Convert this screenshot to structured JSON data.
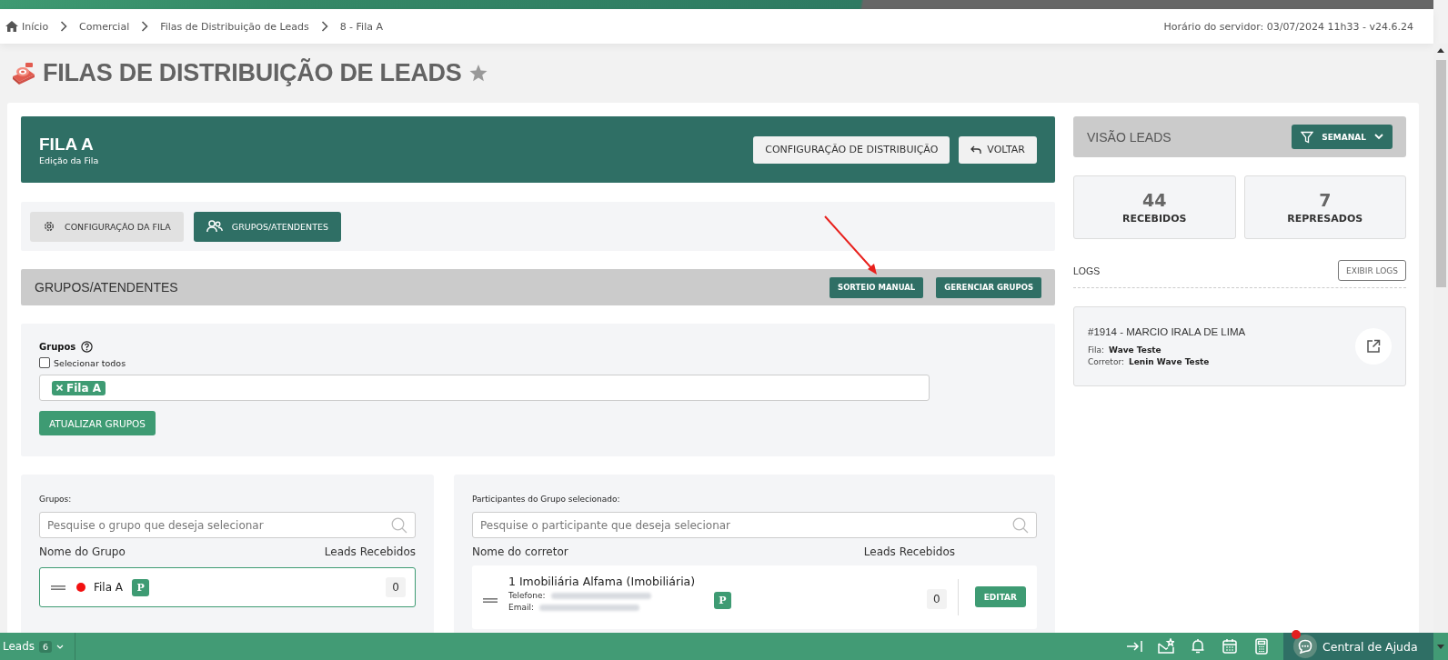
{
  "breadcrumb": [
    {
      "label": "Início",
      "kind": "home"
    },
    {
      "label": "Comercial",
      "kind": "link"
    },
    {
      "label": "Filas de Distribuição de Leads",
      "kind": "link"
    },
    {
      "label": "8 - Fila A",
      "kind": "current"
    }
  ],
  "server_time": "Horário do servidor: 03/07/2024 11h33 - v24.6.24",
  "page_title": "FILAS DE DISTRIBUIÇÃO DE LEADS",
  "favorite": false,
  "queue_header": {
    "title": "FILA A",
    "subtitle": "Edição da Fila",
    "buttons": [
      {
        "label": "CONFIGURAÇÃO DE DISTRIBUIÇÃO",
        "kind": "plain"
      },
      {
        "label": "VOLTAR",
        "kind": "back"
      }
    ]
  },
  "tabs": [
    {
      "label": "CONFIGURAÇÃO DA FILA",
      "kind": "gear",
      "selected": false
    },
    {
      "label": "GRUPOS/ATENDENTES",
      "kind": "users",
      "selected": true
    }
  ],
  "section": {
    "title": "GRUPOS/ATENDENTES",
    "buttons": [
      "SORTEIO MANUAL",
      "GERENCIAR GRUPOS"
    ]
  },
  "groups_form": {
    "label": "Grupos",
    "select_all": {
      "label": "Selecionar todos",
      "checked": false
    },
    "tags": [
      "Fila A"
    ],
    "submit": "ATUALIZAR GRUPOS"
  },
  "groups_list": {
    "label": "Grupos:",
    "search_placeholder": "Pesquise o grupo que deseja selecionar",
    "columns": [
      "Nome do Grupo",
      "Leads Recebidos"
    ],
    "rows": [
      {
        "name": "Fila A",
        "color": "#f21010",
        "badge": "P",
        "count": "0",
        "selected": true
      }
    ]
  },
  "participants": {
    "label": "Participantes do Grupo selecionado:",
    "search_placeholder": "Pesquise o participante que deseja selecionar",
    "columns": [
      "Nome do corretor",
      "Leads Recebidos"
    ],
    "rows": [
      {
        "name": "1 Imobiliária Alfama (Imobiliária)",
        "phone_label": "Telefone:",
        "email_label": "Email:",
        "badge": "P",
        "count": "0",
        "action": "EDITAR"
      }
    ]
  },
  "overview": {
    "title": "VISÃO LEADS",
    "filter": "SEMANAL",
    "stats": [
      {
        "value": "44",
        "label": "RECEBIDOS"
      },
      {
        "value": "7",
        "label": "REPRESADOS"
      }
    ]
  },
  "logs": {
    "title": "LOGS",
    "button": "EXIBIR LOGS",
    "entries": [
      {
        "title": "#1914 - MARCIO IRALA DE LIMA",
        "fields": [
          {
            "label": "Fila:",
            "value": "Wave Teste"
          },
          {
            "label": "Corretor:",
            "value": "Lenin Wave Teste"
          }
        ]
      }
    ]
  },
  "bottom_bar": {
    "leads_label": "Leads",
    "leads_count": "6",
    "help_label": "Central de Ajuda",
    "help_notification": true
  }
}
